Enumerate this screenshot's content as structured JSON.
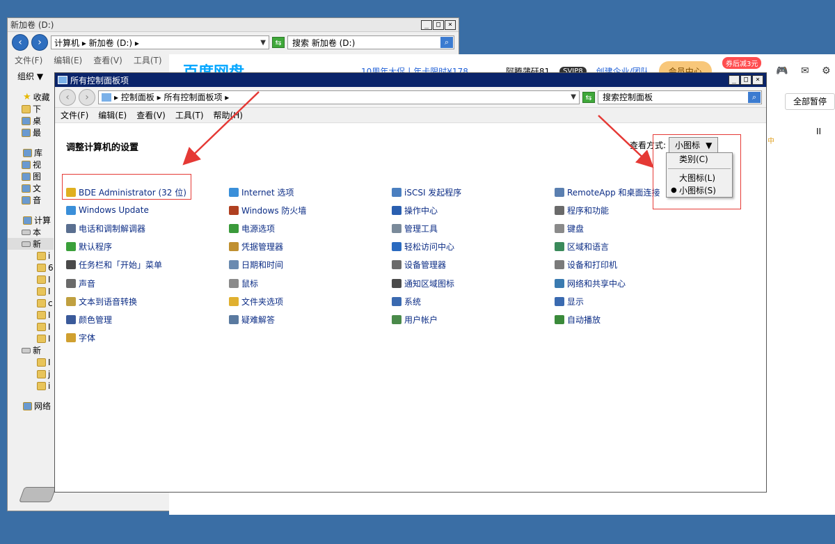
{
  "bg_window": {
    "title": "新加卷 (D:)",
    "address": "计算机 ▸ 新加卷 (D:) ▸",
    "search_placeholder": "搜索 新加卷 (D:)",
    "menu": [
      "文件(F)",
      "编辑(E)",
      "查看(V)",
      "工具(T)"
    ],
    "organize": "组织 ▼",
    "tree": [
      {
        "label": "收藏",
        "icon": "star-icon",
        "level": 0
      },
      {
        "label": "下",
        "icon": "folder-icon",
        "level": 1
      },
      {
        "label": "桌",
        "icon": "desktop-icon",
        "level": 1
      },
      {
        "label": "最",
        "icon": "recent-icon",
        "level": 1
      },
      {
        "label": "",
        "icon": "",
        "level": -1
      },
      {
        "label": "库",
        "icon": "library-icon",
        "level": 0
      },
      {
        "label": "视",
        "icon": "video-icon",
        "level": 1
      },
      {
        "label": "图",
        "icon": "picture-icon",
        "level": 1
      },
      {
        "label": "文",
        "icon": "document-icon",
        "level": 1
      },
      {
        "label": "音",
        "icon": "music-icon",
        "level": 1
      },
      {
        "label": "",
        "icon": "",
        "level": -1
      },
      {
        "label": "计算",
        "icon": "computer-icon",
        "level": 0
      },
      {
        "label": "本",
        "icon": "disk-icon",
        "level": 1
      },
      {
        "label": "新",
        "icon": "disk-icon",
        "level": 1,
        "selected": true
      },
      {
        "label": "i",
        "icon": "folder-icon",
        "level": 2
      },
      {
        "label": "6",
        "icon": "folder-icon",
        "level": 2
      },
      {
        "label": "I",
        "icon": "folder-icon",
        "level": 2
      },
      {
        "label": "I",
        "icon": "folder-icon",
        "level": 2
      },
      {
        "label": "c",
        "icon": "folder-icon",
        "level": 2
      },
      {
        "label": "I",
        "icon": "folder-icon",
        "level": 2
      },
      {
        "label": "I",
        "icon": "folder-icon",
        "level": 2
      },
      {
        "label": "I",
        "icon": "folder-icon",
        "level": 2
      },
      {
        "label": "新",
        "icon": "disk-icon",
        "level": 1
      },
      {
        "label": "I",
        "icon": "folder-icon",
        "level": 2
      },
      {
        "label": "j",
        "icon": "folder-icon",
        "level": 2
      },
      {
        "label": "i",
        "icon": "folder-icon",
        "level": 2
      },
      {
        "label": "",
        "icon": "",
        "level": -1
      },
      {
        "label": "网络",
        "icon": "network-icon",
        "level": 0
      }
    ]
  },
  "baidu": {
    "logo": "百度网盘",
    "promo": "10周年大促丨年卡限时¥178",
    "username": "阿腾蒲矸81",
    "level": "SVIP8",
    "create": "创建企业/团队",
    "vip": "会员中心",
    "badge": "券后减3元",
    "pause_all": "全部暂停",
    "pause_icon": "II",
    "side_text": "中"
  },
  "cp_window": {
    "title": "所有控制面板项",
    "breadcrumb": "▸ 控制面板 ▸ 所有控制面板项 ▸",
    "search_placeholder": "搜索控制面板",
    "menu": [
      "文件(F)",
      "编辑(E)",
      "查看(V)",
      "工具(T)",
      "帮助(H)"
    ],
    "heading": "调整计算机的设置",
    "view_by_label": "查看方式:",
    "view_by_value": "小图标",
    "dropdown": {
      "category": "类别(C)",
      "large": "大图标(L)",
      "small": "小图标(S)"
    },
    "items": [
      {
        "label": "BDE Administrator (32 位)",
        "icon": "bde-icon",
        "color": "#e0b020"
      },
      {
        "label": "Internet 选项",
        "icon": "internet-icon",
        "color": "#3a8fd9"
      },
      {
        "label": "iSCSI 发起程序",
        "icon": "iscsi-icon",
        "color": "#4a7fc0"
      },
      {
        "label": "RemoteApp 和桌面连接",
        "icon": "remoteapp-icon",
        "color": "#5a7fb0"
      },
      {
        "label": "Windows Update",
        "icon": "windows-update-icon",
        "color": "#3a8fd9"
      },
      {
        "label": "Windows 防火墙",
        "icon": "firewall-icon",
        "color": "#b04020"
      },
      {
        "label": "操作中心",
        "icon": "flag-icon",
        "color": "#2a5fb0"
      },
      {
        "label": "程序和功能",
        "icon": "programs-icon",
        "color": "#6a6a6a"
      },
      {
        "label": "电话和调制解调器",
        "icon": "phone-icon",
        "color": "#5a6f90"
      },
      {
        "label": "电源选项",
        "icon": "power-icon",
        "color": "#3a9a3a"
      },
      {
        "label": "管理工具",
        "icon": "admin-tools-icon",
        "color": "#7a8a9a"
      },
      {
        "label": "键盘",
        "icon": "keyboard-icon",
        "color": "#8a8a8a"
      },
      {
        "label": "默认程序",
        "icon": "default-programs-icon",
        "color": "#3aa03a"
      },
      {
        "label": "凭据管理器",
        "icon": "credential-icon",
        "color": "#c09030"
      },
      {
        "label": "轻松访问中心",
        "icon": "ease-access-icon",
        "color": "#2a6ac0"
      },
      {
        "label": "区域和语言",
        "icon": "region-icon",
        "color": "#3a8a5a"
      },
      {
        "label": "任务栏和「开始」菜单",
        "icon": "taskbar-icon",
        "color": "#4a4a4a"
      },
      {
        "label": "日期和时间",
        "icon": "clock-icon",
        "color": "#6a8ab0"
      },
      {
        "label": "设备管理器",
        "icon": "device-manager-icon",
        "color": "#6a6a6a"
      },
      {
        "label": "设备和打印机",
        "icon": "printer-icon",
        "color": "#7a7a7a"
      },
      {
        "label": "声音",
        "icon": "speaker-icon",
        "color": "#6a6a6a"
      },
      {
        "label": "鼠标",
        "icon": "mouse-icon",
        "color": "#8a8a8a"
      },
      {
        "label": "通知区域图标",
        "icon": "notification-icon",
        "color": "#4a4a4a"
      },
      {
        "label": "网络和共享中心",
        "icon": "network-sharing-icon",
        "color": "#3a7ab0"
      },
      {
        "label": "文本到语音转换",
        "icon": "speech-icon",
        "color": "#c0a040"
      },
      {
        "label": "文件夹选项",
        "icon": "folder-options-icon",
        "color": "#e0b030"
      },
      {
        "label": "系统",
        "icon": "system-icon",
        "color": "#3a6ab0"
      },
      {
        "label": "显示",
        "icon": "display-icon",
        "color": "#3a6ab0"
      },
      {
        "label": "颜色管理",
        "icon": "color-mgmt-icon",
        "color": "#3a5a9a"
      },
      {
        "label": "疑难解答",
        "icon": "troubleshoot-icon",
        "color": "#5a7aa0"
      },
      {
        "label": "用户帐户",
        "icon": "user-accounts-icon",
        "color": "#4a8a4a"
      },
      {
        "label": "自动播放",
        "icon": "autoplay-icon",
        "color": "#3a8a3a"
      },
      {
        "label": "字体",
        "icon": "fonts-icon",
        "color": "#d0a030"
      }
    ]
  },
  "colors": {
    "annotation": "#e53935",
    "titlebar": "#0a246a",
    "link": "#0b2c85",
    "desktop": "#3a6ea5"
  }
}
